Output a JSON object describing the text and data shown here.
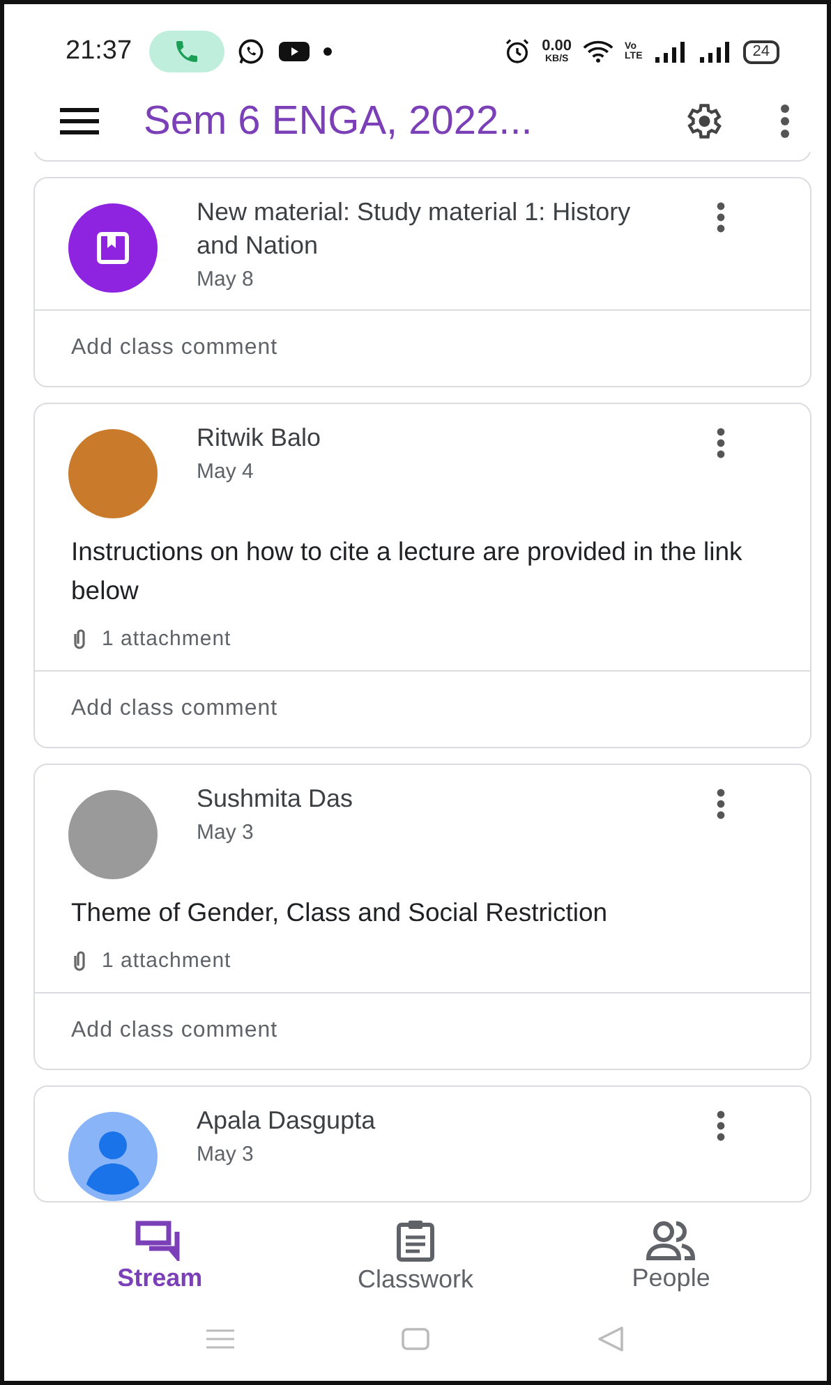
{
  "status_bar": {
    "time": "21:37",
    "speed_value": "0.00",
    "speed_unit": "KB/S",
    "volte_top": "Vo",
    "volte_bottom": "LTE",
    "battery": "24"
  },
  "header": {
    "title": "Sem 6 ENGA, 2022..."
  },
  "posts": [
    {
      "kind": "material",
      "avatar": {
        "kind": "icon"
      },
      "title": "New material: Study material 1: History and Nation",
      "date": "May 8",
      "comment_placeholder": "Add class comment"
    },
    {
      "kind": "announcement",
      "avatar": {
        "kind": "photo"
      },
      "author": "Ritwik Balo",
      "date": "May 4",
      "body": "Instructions on how to cite a lecture are provided in the link below",
      "attachment": "1 attachment",
      "comment_placeholder": "Add class comment"
    },
    {
      "kind": "announcement",
      "avatar": {
        "kind": "photo"
      },
      "author": "Sushmita Das",
      "date": "May 3",
      "body": "Theme of Gender, Class and Social Restriction",
      "attachment": "1 attachment",
      "comment_placeholder": "Add class comment"
    },
    {
      "kind": "announcement",
      "avatar": {
        "kind": "default"
      },
      "author": "Apala Dasgupta",
      "date": "May 3"
    }
  ],
  "bottom_nav": [
    {
      "label": "Stream",
      "selected": true
    },
    {
      "label": "Classwork",
      "selected": false
    },
    {
      "label": "People",
      "selected": false
    }
  ]
}
